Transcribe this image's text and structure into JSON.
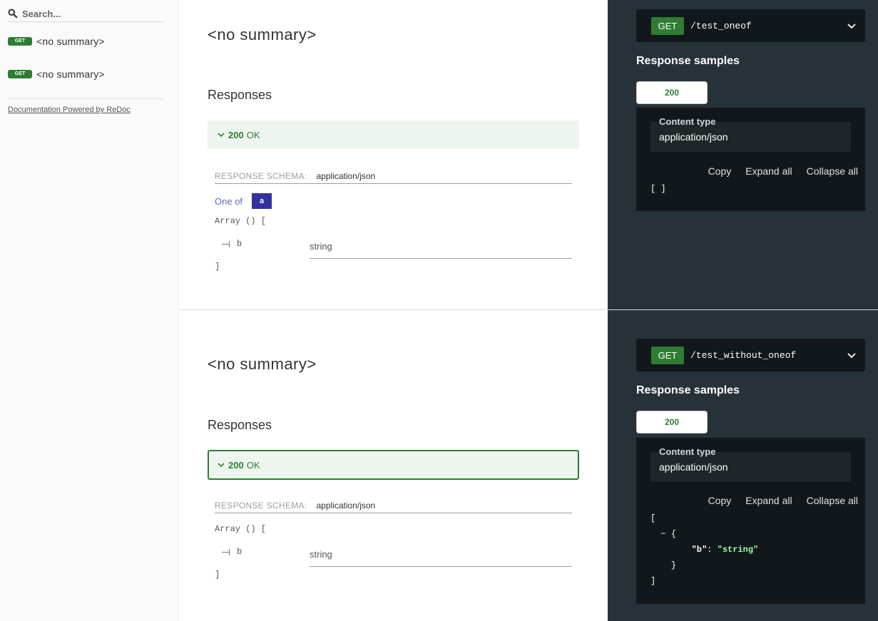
{
  "sidebar": {
    "search_placeholder": "Search...",
    "items": [
      {
        "method": "GET",
        "label": "<no summary>"
      },
      {
        "method": "GET",
        "label": "<no summary>"
      }
    ],
    "powered_by": "Documentation Powered by ReDoc"
  },
  "operations": [
    {
      "title": "<no summary>",
      "responses_heading": "Responses",
      "response": {
        "code": "200",
        "text": "OK"
      },
      "schema_label": "RESPONSE SCHEMA:",
      "schema_type": "application/json",
      "one_of_label": "One of",
      "one_of_option": "a",
      "array_open": "Array () [",
      "prop_name": "b",
      "prop_type": "string",
      "array_close": "]",
      "endpoint": {
        "method": "GET",
        "path": "/test_oneof"
      },
      "samples_title": "Response samples",
      "tab": "200",
      "content_type_label": "Content type",
      "content_type": "application/json",
      "actions": {
        "copy": "Copy",
        "expand": "Expand all",
        "collapse": "Collapse all"
      },
      "code": "[ ]"
    },
    {
      "title": "<no summary>",
      "responses_heading": "Responses",
      "response": {
        "code": "200",
        "text": "OK"
      },
      "schema_label": "RESPONSE SCHEMA:",
      "schema_type": "application/json",
      "array_open": "Array () [",
      "prop_name": "b",
      "prop_type": "string",
      "array_close": "]",
      "endpoint": {
        "method": "GET",
        "path": "/test_without_oneof"
      },
      "samples_title": "Response samples",
      "tab": "200",
      "content_type_label": "Content type",
      "content_type": "application/json",
      "actions": {
        "copy": "Copy",
        "expand": "Expand all",
        "collapse": "Collapse all"
      },
      "code_lines": {
        "open": "[",
        "toggle": "−",
        "obj_open": "{",
        "key": "\"b\"",
        "colon": ": ",
        "value": "\"string\"",
        "obj_close": "}",
        "close": "]"
      }
    }
  ],
  "colors": {
    "accent_green": "#2e7d32",
    "oneof_purple": "#32329f",
    "panel_bg": "#263238",
    "code_bg": "#11171a"
  }
}
